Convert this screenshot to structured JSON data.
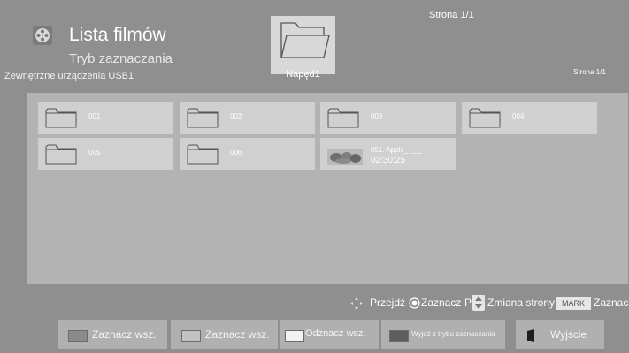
{
  "header": {
    "app_title": "Lista filmów",
    "mode_title": "Tryb zaznaczania",
    "source_label": "Zewnętrzne urządzenia USB1",
    "drive_label": "Napęd1",
    "page_top": "Strona 1/1",
    "page_right": "Strona 1/1"
  },
  "items": [
    {
      "type": "folder",
      "label": "001"
    },
    {
      "type": "folder",
      "label": "002"
    },
    {
      "type": "folder",
      "label": "003"
    },
    {
      "type": "folder",
      "label": "004"
    },
    {
      "type": "folder",
      "label": "005"
    },
    {
      "type": "folder",
      "label": "006"
    },
    {
      "type": "video",
      "name": "051. Apple_ ___",
      "duration": "02:30:25"
    }
  ],
  "help": {
    "move": "Przejdź",
    "select": "Zaznacz",
    "page_prefix": "P",
    "change_page": "Zmiana strony",
    "mark_key": "MARK",
    "mark_label": "Zaznacz"
  },
  "buttons": {
    "select_all_red": "Zaznacz wsz.",
    "select_all_green": "Zaznacz wsz.",
    "deselect_all": "Odznacz wsz.",
    "exit_select_mode": "Wyjdź z trybu zaznaczania",
    "exit": "Wyjście"
  },
  "colors": {
    "background": "#8f8f8f",
    "panel": "#b3b3b3",
    "tile": "#d0d0d0",
    "button": "#b0b0b0",
    "swatch_red": "#8a8a8a",
    "swatch_green": "#c2c2c2",
    "swatch_yellow": "#f2f2f2",
    "swatch_blue": "#5d5d5d"
  }
}
